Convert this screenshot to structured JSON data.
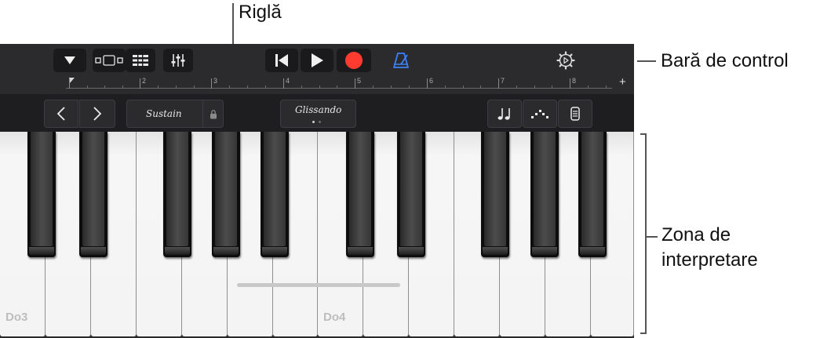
{
  "callouts": {
    "ruler": "Riglă",
    "control_bar": "Bară de control",
    "play_area_line1": "Zona de",
    "play_area_line2": "interpretare"
  },
  "control_bar": {
    "icons": [
      "triangle-down-icon",
      "tracks-view-icon",
      "browser-list-icon",
      "mixer-icon",
      "go-to-beginning-icon",
      "play-icon",
      "record-icon",
      "metronome-icon",
      "settings-gear-icon"
    ],
    "colors": {
      "record": "#ff3b30",
      "metronome": "#3a82f6"
    }
  },
  "ruler": {
    "bar_numbers": [
      "2",
      "3",
      "4",
      "5",
      "6",
      "7",
      "8"
    ],
    "add_label": "+"
  },
  "keyboard_controls": {
    "sustain_label": "Sustain",
    "glissando_label": "Glissando",
    "icons": [
      "chevron-left-icon",
      "chevron-right-icon",
      "lock-icon",
      "notes-icon",
      "arpeggiator-icon",
      "keyboard-size-icon"
    ]
  },
  "keyboard": {
    "labels": [
      "Do3",
      "Do4"
    ]
  }
}
